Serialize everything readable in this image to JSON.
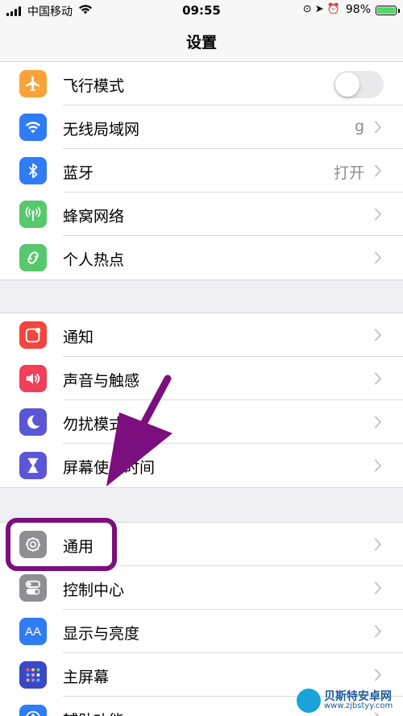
{
  "status_bar": {
    "carrier": "中国移动",
    "time": "09:55",
    "battery_percent": "98%",
    "battery_level": 0.98
  },
  "nav": {
    "title": "设置"
  },
  "groups": [
    {
      "items": [
        {
          "label": "飞行模式",
          "value": "",
          "control": "toggle",
          "toggle_on": false,
          "icon": "airplane-icon",
          "color": "#f7a33a"
        },
        {
          "label": "无线局域网",
          "value": "g",
          "control": "chevron",
          "icon": "wifi-icon",
          "color": "#2f7cf6"
        },
        {
          "label": "蓝牙",
          "value": "打开",
          "control": "chevron",
          "icon": "bluetooth-icon",
          "color": "#2f7cf6"
        },
        {
          "label": "蜂窝网络",
          "value": "",
          "control": "chevron",
          "icon": "antenna-icon",
          "color": "#57c86b"
        },
        {
          "label": "个人热点",
          "value": "",
          "control": "chevron",
          "icon": "hotspot-link-icon",
          "color": "#57c86b"
        }
      ]
    },
    {
      "items": [
        {
          "label": "通知",
          "value": "",
          "control": "chevron",
          "icon": "notification-icon",
          "color": "#f1453d"
        },
        {
          "label": "声音与触感",
          "value": "",
          "control": "chevron",
          "icon": "speaker-icon",
          "color": "#f03e5b"
        },
        {
          "label": "勿扰模式",
          "value": "",
          "control": "chevron",
          "icon": "moon-icon",
          "color": "#5b56d6"
        },
        {
          "label": "屏幕使用时间",
          "value": "",
          "control": "chevron",
          "icon": "hourglass-icon",
          "color": "#5b56d6"
        }
      ]
    },
    {
      "items": [
        {
          "label": "通用",
          "value": "",
          "control": "chevron",
          "icon": "gear-icon",
          "color": "#8e8e93"
        },
        {
          "label": "控制中心",
          "value": "",
          "control": "chevron",
          "icon": "control-center-icon",
          "color": "#8e8e93"
        },
        {
          "label": "显示与亮度",
          "value": "",
          "control": "chevron",
          "icon": "text-size-icon",
          "color": "#2f7cf6",
          "icon_text": "AA"
        },
        {
          "label": "主屏幕",
          "value": "",
          "control": "chevron",
          "icon": "home-screen-icon",
          "color": "#3a48c8"
        },
        {
          "label": "辅助功能",
          "value": "",
          "control": "chevron",
          "icon": "accessibility-icon",
          "color": "#2f7cf6"
        }
      ]
    }
  ],
  "annotation": {
    "arrow_color": "#7b0f7d",
    "highlight_color": "#7b0f7d"
  },
  "watermark": {
    "text": "贝斯特安卓网",
    "url": "www.zjbstyy.com"
  }
}
